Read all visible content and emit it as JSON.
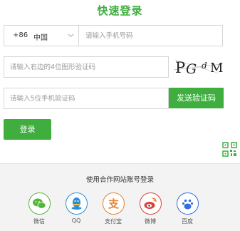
{
  "title": "快速登录",
  "phone": {
    "country_code": "+86",
    "country_name": "中国",
    "placeholder": "请输入手机号码"
  },
  "image_code": {
    "placeholder": "请输入右边的4位图形验证码",
    "captcha_text": "PG dM"
  },
  "sms_code": {
    "placeholder": "请输入5位手机验证码",
    "send_button_label": "发送验证码"
  },
  "login_button_label": "登录",
  "partner_login": {
    "title": "使用合作网站账号登录",
    "providers": [
      {
        "label": "微信",
        "icon": "wechat-icon",
        "color": "#52b83a"
      },
      {
        "label": "QQ",
        "icon": "qq-icon",
        "color": "#2b8fd8"
      },
      {
        "label": "支付宝",
        "icon": "alipay-icon",
        "color": "#e9822a"
      },
      {
        "label": "微博",
        "icon": "weibo-icon",
        "color": "#d9413b"
      },
      {
        "label": "百度",
        "icon": "baidu-icon",
        "color": "#2f6fe0"
      }
    ]
  },
  "colors": {
    "accent": "#3fae3f",
    "input_border": "#d6d6d6",
    "footer_bg": "#f3f3f3"
  }
}
